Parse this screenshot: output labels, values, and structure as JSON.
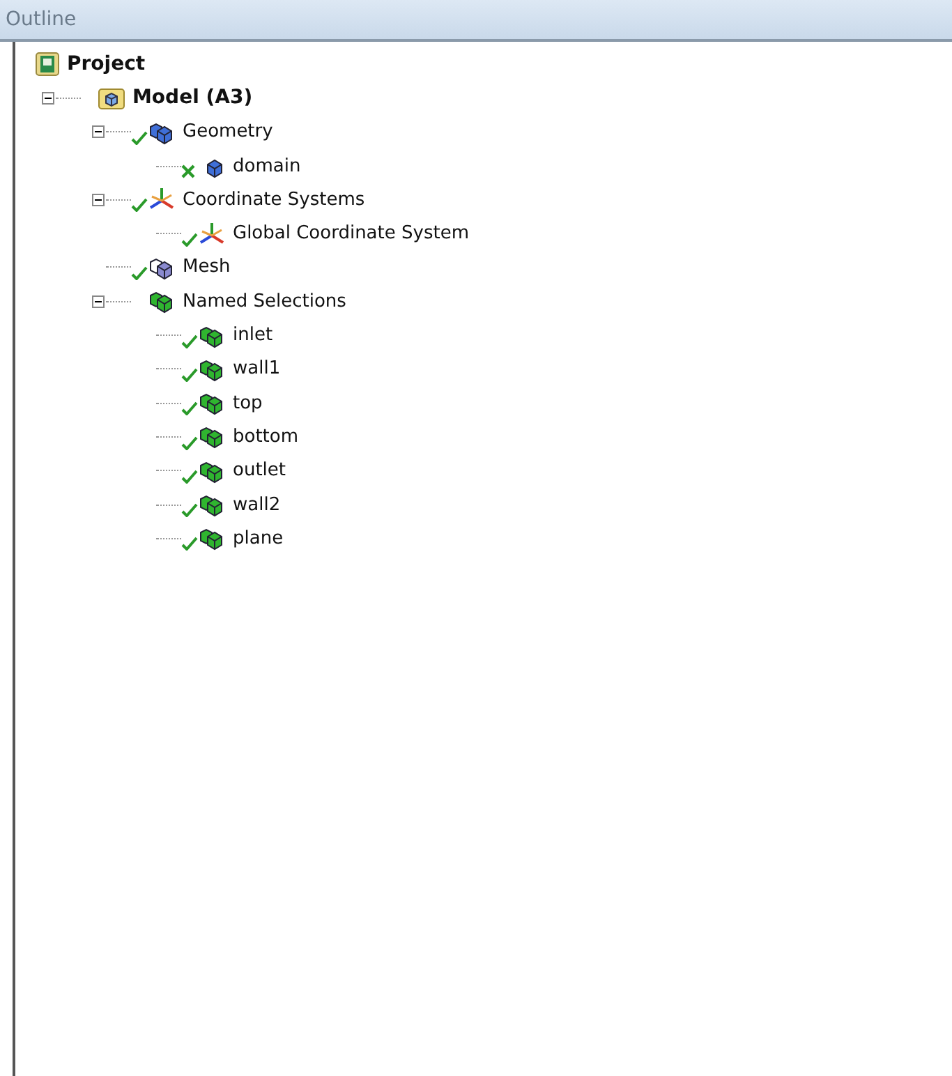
{
  "panel": {
    "title": "Outline"
  },
  "tree": [
    {
      "label": "Project",
      "kind": "project",
      "bold": true,
      "children": [
        {
          "label": "Model (A3)",
          "kind": "model",
          "bold": true,
          "expanded": true,
          "children": [
            {
              "label": "Geometry",
              "kind": "geometry",
              "ok": true,
              "expanded": true,
              "children": [
                {
                  "label": "domain",
                  "kind": "body",
                  "ok": false
                }
              ]
            },
            {
              "label": "Coordinate Systems",
              "kind": "coordinates",
              "ok": true,
              "expanded": true,
              "children": [
                {
                  "label": "Global Coordinate System",
                  "kind": "coordinates",
                  "ok": true
                }
              ]
            },
            {
              "label": "Mesh",
              "kind": "mesh",
              "ok": true
            },
            {
              "label": "Named Selections",
              "kind": "selections",
              "expanded": true,
              "children": [
                {
                  "label": "inlet",
                  "kind": "selection",
                  "ok": true
                },
                {
                  "label": "wall1",
                  "kind": "selection",
                  "ok": true
                },
                {
                  "label": "top",
                  "kind": "selection",
                  "ok": true
                },
                {
                  "label": "bottom",
                  "kind": "selection",
                  "ok": true
                },
                {
                  "label": "outlet",
                  "kind": "selection",
                  "ok": true
                },
                {
                  "label": "wall2",
                  "kind": "selection",
                  "ok": true
                },
                {
                  "label": "plane",
                  "kind": "selection",
                  "ok": true
                }
              ]
            }
          ]
        }
      ]
    }
  ]
}
